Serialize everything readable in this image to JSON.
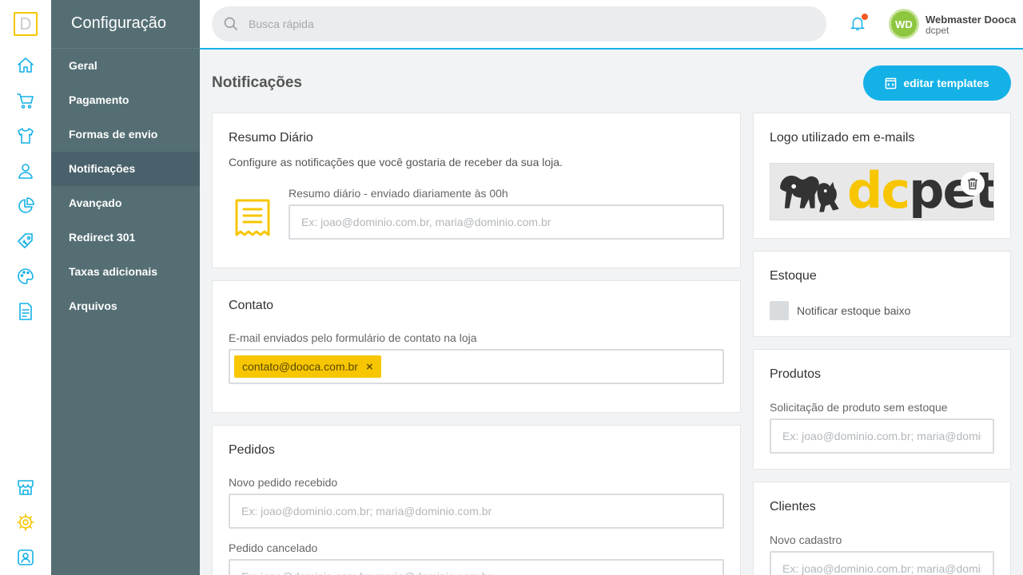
{
  "app": {
    "logo_letter": "D"
  },
  "rail": [
    "home-icon",
    "cart-icon",
    "shirt-icon",
    "customers-icon",
    "reports-icon",
    "tag-icon",
    "palette-icon",
    "pages-icon",
    "store-icon",
    "gear-icon",
    "account-icon"
  ],
  "sidebar": {
    "title": "Configuração",
    "items": [
      {
        "label": "Geral"
      },
      {
        "label": "Pagamento"
      },
      {
        "label": "Formas de envio"
      },
      {
        "label": "Notificações",
        "active": true
      },
      {
        "label": "Avançado"
      },
      {
        "label": "Redirect 301"
      },
      {
        "label": "Taxas adicionais"
      },
      {
        "label": "Arquivos"
      }
    ]
  },
  "topbar": {
    "search_placeholder": "Busca rápida",
    "user_initials": "WD",
    "user_name": "Webmaster Dooca",
    "store_name": "dcpet"
  },
  "main": {
    "title": "Notificações",
    "edit_templates_label": "editar templates",
    "resumo": {
      "title": "Resumo Diário",
      "description": "Configure as notificações que você gostaria de receber da sua loja.",
      "field_label": "Resumo diário - enviado diariamente às 00h",
      "placeholder": "Ex: joao@dominio.com.br, maria@dominio.com.br"
    },
    "contato": {
      "title": "Contato",
      "field_label": "E-mail enviados pelo formulário de contato na loja",
      "tag": "contato@dooca.com.br",
      "tag_remove": "×"
    },
    "pedidos": {
      "title": "Pedidos",
      "novo_label": "Novo pedido recebido",
      "novo_placeholder": "Ex: joao@dominio.com.br; maria@dominio.com.br",
      "cancelado_label": "Pedido cancelado",
      "cancelado_placeholder": "Ex: joao@dominio.com.br; maria@dominio.com.br"
    },
    "logo": {
      "title": "Logo utilizado em e-mails",
      "brand_part1": "dc",
      "brand_part2": "pet"
    },
    "estoque": {
      "title": "Estoque",
      "checkbox_label": "Notificar estoque baixo",
      "checked": false
    },
    "produtos": {
      "title": "Produtos",
      "field_label": "Solicitação de produto sem estoque",
      "placeholder": "Ex: joao@dominio.com.br; maria@dominio.com.br"
    },
    "clientes": {
      "title": "Clientes",
      "field_label": "Novo cadastro",
      "placeholder": "Ex: joao@dominio.com.br; maria@dominio.com.br"
    }
  },
  "colors": {
    "accent": "#14b1e6",
    "brand_yellow": "#f7c600",
    "sidebar": "#546e74",
    "sidebar_active": "#49616a"
  }
}
